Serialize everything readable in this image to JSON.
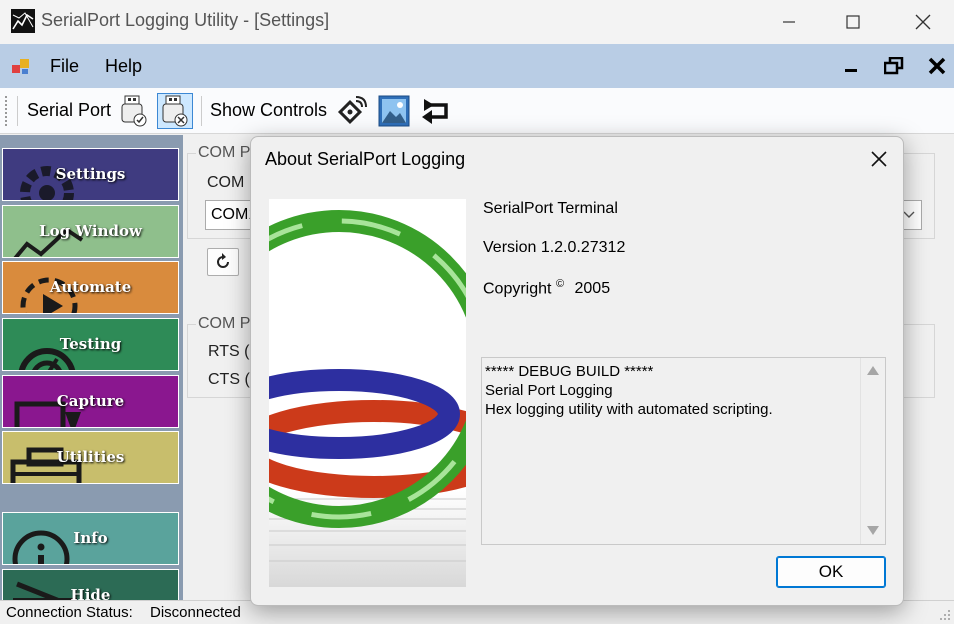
{
  "window": {
    "title": "SerialPort Logging Utility - [Settings]",
    "controls": [
      "minimize",
      "maximize",
      "close"
    ]
  },
  "menu": {
    "items": [
      {
        "label": "File"
      },
      {
        "label": "Help"
      }
    ]
  },
  "toolbar": {
    "serial_port_label": "Serial Port",
    "show_controls_label": "Show Controls",
    "icons": [
      "usb-connect-icon",
      "usb-disconnect-icon",
      "antenna-icon",
      "picture-icon",
      "return-arrow-icon"
    ]
  },
  "sidebar": {
    "items": [
      {
        "label": "Settings",
        "color": "#3f3b80",
        "icon": "gear-icon"
      },
      {
        "label": "Log Window",
        "color": "#8fbf8c",
        "icon": "chart-icon"
      },
      {
        "label": "Automate",
        "color": "#d98b3d",
        "icon": "play-icon"
      },
      {
        "label": "Testing",
        "color": "#2e8b57",
        "icon": "gauge-icon"
      },
      {
        "label": "Capture",
        "color": "#8a178f",
        "icon": "capture-icon"
      },
      {
        "label": "Utilities",
        "color": "#c8be6c",
        "icon": "toolbox-icon"
      },
      {
        "label": "Info",
        "color": "#5aa39c",
        "icon": "info-icon"
      },
      {
        "label": "Hide",
        "color": "#2c6b55",
        "icon": "hide-icon"
      }
    ]
  },
  "settings_panel": {
    "com_port_group_label": "COM P",
    "com_port_field_label": "COM",
    "com_port_value": "COM1",
    "com_pins_group_label": "COM P",
    "rts_label": "RTS (",
    "cts_label": "CTS ("
  },
  "status": {
    "label": "Connection Status:",
    "value": "Disconnected"
  },
  "dialog": {
    "title": "About SerialPort Logging",
    "product": "SerialPort Terminal",
    "version": "Version 1.2.0.27312",
    "copyright_label": "Copyright",
    "copyright_symbol": "©",
    "copyright_year": "2005",
    "description": {
      "line1": "***** DEBUG BUILD *****",
      "line2": "Serial Port Logging",
      "line3": "Hex logging utility with automated scripting."
    },
    "ok_label": "OK"
  },
  "colors": {
    "menubar": "#b9cde5",
    "sidebar_background": "#8a9bb0",
    "accent": "#0078d4"
  }
}
